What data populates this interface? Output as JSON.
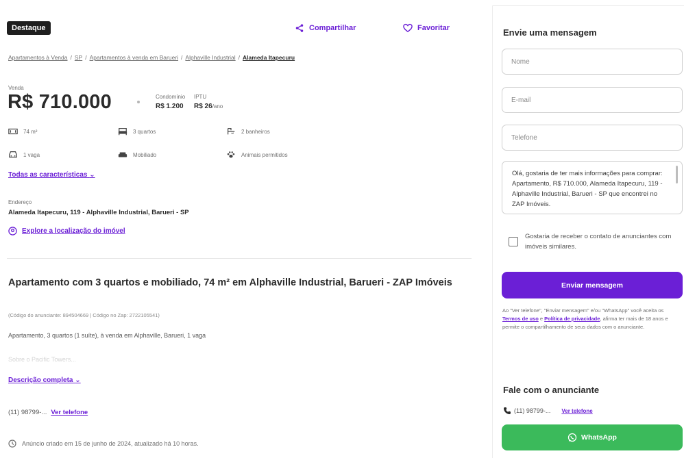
{
  "header": {
    "badge": "Destaque",
    "share_label": "Compartilhar",
    "favorite_label": "Favoritar"
  },
  "breadcrumb": {
    "items": [
      "Apartamentos à Venda",
      "SP",
      "Apartamentos à venda em Barueri",
      "Alphaville Industrial"
    ],
    "current": "Alameda Itapecuru"
  },
  "pricing": {
    "sale_label": "Venda",
    "price": "R$ 710.000",
    "condo_label": "Condomínio",
    "condo_value": "R$ 1.200",
    "iptu_label": "IPTU",
    "iptu_value": "R$ 26",
    "iptu_period": "/ano"
  },
  "features": [
    {
      "icon": "area-icon",
      "label": "74 m²"
    },
    {
      "icon": "bed-icon",
      "label": "3 quartos"
    },
    {
      "icon": "bath-icon",
      "label": "2 banheiros"
    },
    {
      "icon": "car-icon",
      "label": "1 vaga"
    },
    {
      "icon": "sofa-icon",
      "label": "Mobiliado"
    },
    {
      "icon": "paw-icon",
      "label": "Animais permitidos"
    }
  ],
  "all_characteristics": "Todas as características",
  "address": {
    "label": "Endereço",
    "value": "Alameda Itapecuru, 119 - Alphaville Industrial, Barueri - SP",
    "explore": "Explore a localização do imóvel"
  },
  "listing": {
    "title": "Apartamento com 3 quartos e mobiliado, 74 m² em Alphaville Industrial, Barueri - ZAP Imóveis",
    "codes": "(Código do anunciante: 894504669 | Código no Zap: 2722105541)",
    "short_description": "Apartamento, 3 quartos (1 suíte), à venda em Alphaville, Barueri, 1 vaga",
    "faded_text": "Sobre o Pacific Towers...",
    "full_description": "Descrição completa",
    "phone": "(11) 98799-...",
    "see_phone": "Ver telefone",
    "created": "Anúncio criado em 15 de junho de 2024, atualizado há 10 horas."
  },
  "contact_form": {
    "title": "Envie uma mensagem",
    "name_placeholder": "Nome",
    "email_placeholder": "E-mail",
    "phone_placeholder": "Telefone",
    "message": "Olá, gostaria de ter mais informações para comprar: Apartamento, R$ 710.000, Alameda Itapecuru, 119 - Alphaville Industrial, Barueri - SP que encontrei no ZAP Imóveis.",
    "checkbox_label": "Gostaria de receber o contato de anunciantes com imóveis similares.",
    "send_label": "Enviar mensagem",
    "legal_prefix": "Ao \"Ver telefone\", \"Enviar mensagem\" e/ou \"WhatsApp\" você aceita os",
    "terms": "Termos de uso",
    "legal_and": "e",
    "privacy": "Política de privacidade",
    "legal_suffix": ", afirma ter mais de 18 anos e permite o compartilhamento de seus dados com o anunciante."
  },
  "advertiser": {
    "title": "Fale com o anunciante",
    "phone": "(11) 98799-...",
    "see_phone": "Ver telefone",
    "whatsapp": "WhatsApp"
  },
  "colors": {
    "accent": "#6b1fd6",
    "whatsapp": "#3bba5b",
    "badge": "#1f1f1f"
  }
}
